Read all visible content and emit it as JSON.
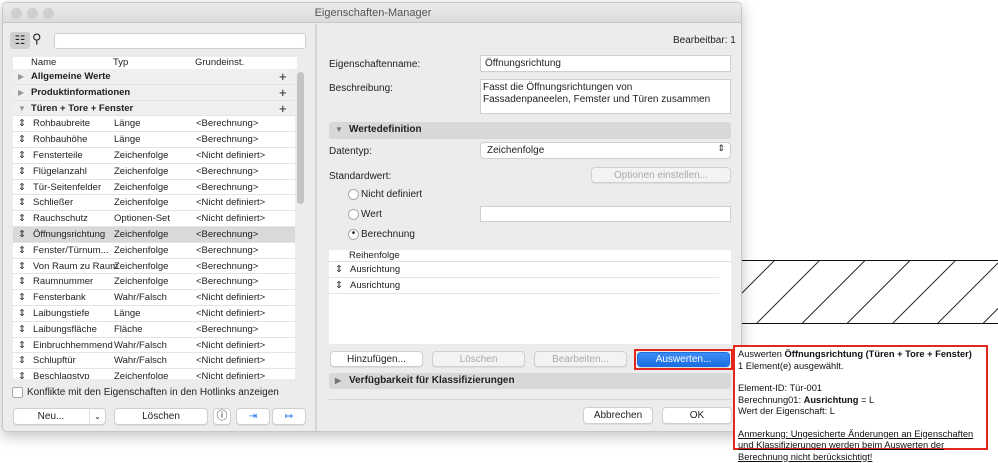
{
  "window": {
    "title": "Eigenschaften-Manager"
  },
  "left": {
    "search_placeholder": "",
    "columns": [
      "Name",
      "Typ",
      "Grundeinst."
    ],
    "groups": [
      "Allgemeine Werte",
      "Produktinformationen",
      "Türen + Tore + Fenster"
    ],
    "rows": [
      {
        "name": "Rohbaubreite",
        "type": "Länge",
        "default": "<Berechnung>"
      },
      {
        "name": "Rohbauhöhe",
        "type": "Länge",
        "default": "<Berechnung>"
      },
      {
        "name": "Fensterteile",
        "type": "Zeichenfolge",
        "default": "<Nicht definiert>"
      },
      {
        "name": "Flügelanzahl",
        "type": "Zeichenfolge",
        "default": "<Berechnung>"
      },
      {
        "name": "Tür-Seitenfelder",
        "type": "Zeichenfolge",
        "default": "<Berechnung>"
      },
      {
        "name": "Schließer",
        "type": "Zeichenfolge",
        "default": "<Nicht definiert>"
      },
      {
        "name": "Rauchschutz",
        "type": "Optionen-Set",
        "default": "<Nicht definiert>"
      },
      {
        "name": "Öffnungsrichtung",
        "type": "Zeichenfolge",
        "default": "<Berechnung>"
      },
      {
        "name": "Fenster/Türnum...",
        "type": "Zeichenfolge",
        "default": "<Berechnung>"
      },
      {
        "name": "Von Raum zu Raum",
        "type": "Zeichenfolge",
        "default": "<Berechnung>"
      },
      {
        "name": "Raumnummer",
        "type": "Zeichenfolge",
        "default": "<Berechnung>"
      },
      {
        "name": "Fensterbank",
        "type": "Wahr/Falsch",
        "default": "<Nicht definiert>"
      },
      {
        "name": "Laibungstiefe",
        "type": "Länge",
        "default": "<Nicht definiert>"
      },
      {
        "name": "Laibungsfläche",
        "type": "Fläche",
        "default": "<Berechnung>"
      },
      {
        "name": "Einbruchhemmend",
        "type": "Wahr/Falsch",
        "default": "<Nicht definiert>"
      },
      {
        "name": "Schlupftür",
        "type": "Wahr/Falsch",
        "default": "<Nicht definiert>"
      },
      {
        "name": "Beschlagstyp",
        "type": "Zeichenfolge",
        "default": "<Nicht definiert>"
      }
    ],
    "hotlink_checkbox": "Konflikte mit den Eigenschaften in den Hotlinks anzeigen",
    "new_button": "Neu...",
    "delete_button": "Löschen"
  },
  "right": {
    "editable": "Bearbeitbar: 1",
    "name_label": "Eigenschaftenname:",
    "name_value": "Öffnungsrichtung",
    "desc_label": "Beschreibung:",
    "desc_value": "Fasst die Öffnungsrichtungen von Fassadenpaneelen, Femster und Türen zusammen",
    "value_def": "Wertedefinition",
    "datatype_label": "Datentyp:",
    "datatype_value": "Zeichenfolge",
    "default_label": "Standardwert:",
    "options_button": "Optionen einstellen...",
    "radio_undefined": "Nicht definiert",
    "radio_value": "Wert",
    "radio_calc": "Berechnung",
    "list_header": "Reihenfolge",
    "list_items": [
      "Ausrichtung",
      "Ausrichtung"
    ],
    "add_button": "Hinzufügen...",
    "delete_button": "Löschen",
    "edit_button": "Bearbeiten...",
    "evaluate_button": "Auswerten...",
    "availability": "Verfügbarkeit für Klassifizierungen",
    "cancel_button": "Abbrechen",
    "ok_button": "OK"
  },
  "tooltip": {
    "l1a": "Auswerten ",
    "l1b": "Öffnungsrichtung (Türen + Tore + Fenster)",
    "l2": "1 Element(e) ausgewählt.",
    "l3": "Element-ID: Tür-001",
    "l4a": "Berechnung01: ",
    "l4b": "Ausrichtung",
    "l4c": " = L",
    "l5": "Wert der Eigenschaft: L",
    "note": "Anmerkung: Ungesicherte Änderungen an Eigenschaften und Klassifizierungen werden beim Auswerten der Berechnung nicht berücksichtigt!"
  },
  "colors": {
    "accent": "#1a73e8",
    "highlight": "#e3271b"
  }
}
